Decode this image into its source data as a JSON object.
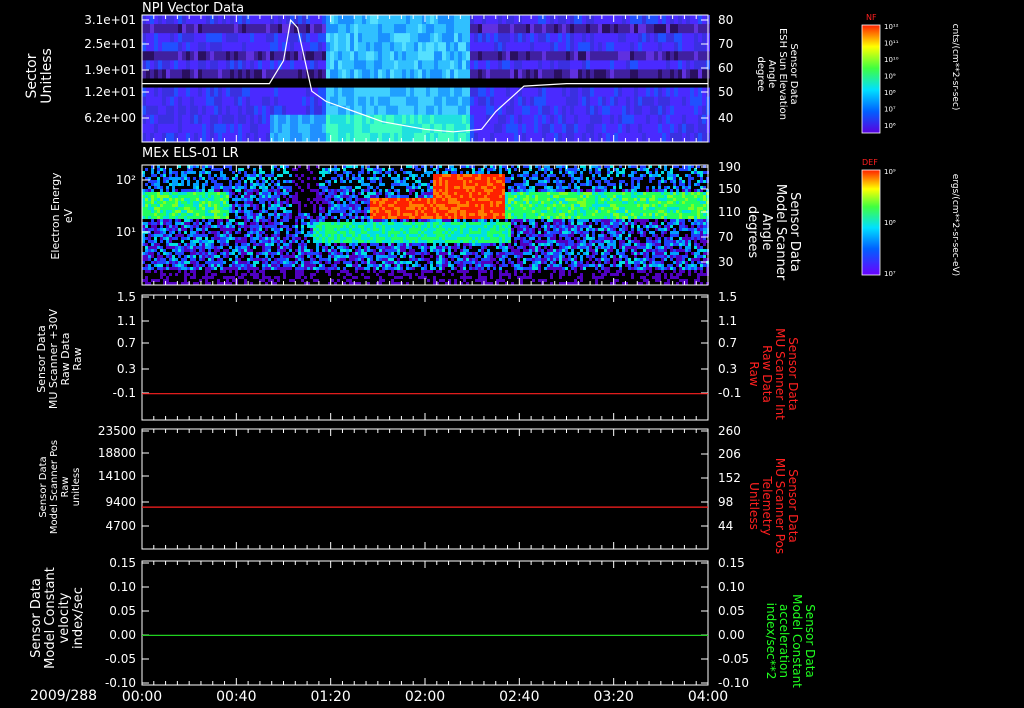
{
  "date_label": "2009/288",
  "time_ticks": [
    "00:00",
    "00:40",
    "01:20",
    "02:00",
    "02:40",
    "03:20",
    "04:00"
  ],
  "colors": {
    "red_axis": "#ff2020",
    "green_axis": "#20ff20",
    "trace_red": "#ff2020",
    "trace_green": "#20d020",
    "trace_white": "#ffffff"
  },
  "chart_data": [
    {
      "type": "heatmap",
      "title": "NPI Vector Data",
      "ylabel_left": [
        "Sector",
        "Unitless"
      ],
      "yticks_left": [
        "3.1e+01",
        "2.5e+01",
        "1.9e+01",
        "1.2e+01",
        "6.2e+00"
      ],
      "ylabel_right": [
        "Sensor Data",
        "ESH Sun Elevation",
        "Angle",
        "degree"
      ],
      "yticks_right": [
        "80",
        "70",
        "60",
        "50",
        "40"
      ],
      "ylim_right": [
        30,
        80
      ],
      "overlay_line": {
        "x_hours": [
          0,
          0.5,
          0.9,
          1.0,
          1.05,
          1.1,
          1.2,
          1.3,
          1.5,
          1.7,
          2.0,
          2.2,
          2.4,
          2.5,
          2.7,
          3.0,
          3.5,
          4.0
        ],
        "y": [
          53,
          53,
          53,
          62,
          78,
          75,
          50,
          46,
          42,
          38,
          35,
          34,
          35,
          42,
          52,
          53,
          53,
          53
        ]
      },
      "colorbar": {
        "label": "NF",
        "max_tick": "10¹²",
        "min_tick": "10⁶",
        "ticks": [
          "10¹²",
          "10¹¹",
          "10¹⁰",
          "10⁹",
          "10⁸",
          "10⁷",
          "10⁶"
        ],
        "units": "cnts/(cm**2-sr-sec)"
      }
    },
    {
      "type": "heatmap",
      "title": "MEx ELS-01 LR",
      "ylabel_left": [
        "Electron Energy",
        "eV"
      ],
      "yticks_left": [
        "10²",
        "10¹"
      ],
      "ylabel_right": [
        "Sensor Data",
        "Model Scanner",
        "Angle",
        "degrees"
      ],
      "yticks_right": [
        "190",
        "150",
        "110",
        "70",
        "30"
      ],
      "colorbar": {
        "label": "DEF",
        "max_tick": "10⁹",
        "mid_tick": "10⁸",
        "min_tick": "10⁷",
        "ticks": [
          "10⁹",
          "10⁸",
          "10⁷"
        ],
        "units": "ergs/(cm**2-sr-sec-eV)"
      }
    },
    {
      "type": "line",
      "ylabel_left": [
        "Sensor Data",
        "MU Scanner +30V",
        "Raw Data",
        "Raw"
      ],
      "yticks_left": [
        "1.5",
        "1.1",
        "0.7",
        "0.3",
        "-0.1"
      ],
      "ylabel_right": [
        "Sensor Data",
        "MU Scanner Int",
        "Raw Data",
        "Raw"
      ],
      "yticks_right": [
        "1.5",
        "1.1",
        "0.7",
        "0.3",
        "-0.1"
      ],
      "ylim": [
        -0.4,
        1.5
      ],
      "series": [
        {
          "x_hours": [
            0,
            4
          ],
          "y": [
            0,
            0
          ]
        }
      ]
    },
    {
      "type": "line",
      "ylabel_left": [
        "Sensor Data",
        "Model Scanner Pos",
        "Raw",
        "unitless"
      ],
      "yticks_left": [
        "23500",
        "18800",
        "14100",
        "9400",
        "4700"
      ],
      "ylabel_right": [
        "Sensor Data",
        "MU Scanner Pos",
        "Telemetry",
        "Unitless"
      ],
      "yticks_right": [
        "260",
        "206",
        "152",
        "98",
        "44"
      ],
      "ylim": [
        0,
        23500
      ],
      "series": [
        {
          "x_hours": [
            0,
            4
          ],
          "y": [
            8200,
            8200
          ]
        }
      ]
    },
    {
      "type": "line",
      "ylabel_left": [
        "Sensor Data",
        "Model Constant",
        "velocity",
        "index/sec"
      ],
      "yticks_left": [
        "0.15",
        "0.10",
        "0.05",
        "0.00",
        "-0.05",
        "-0.10"
      ],
      "ylabel_right": [
        "Sensor Data",
        "Model Constant",
        "acceleration",
        "index/sec**2"
      ],
      "yticks_right": [
        "0.15",
        "0.10",
        "0.05",
        "0.00",
        "-0.05",
        "-0.10"
      ],
      "ylim": [
        -0.1,
        0.15
      ],
      "series": [
        {
          "x_hours": [
            0,
            4
          ],
          "y": [
            0,
            0
          ]
        }
      ]
    }
  ]
}
